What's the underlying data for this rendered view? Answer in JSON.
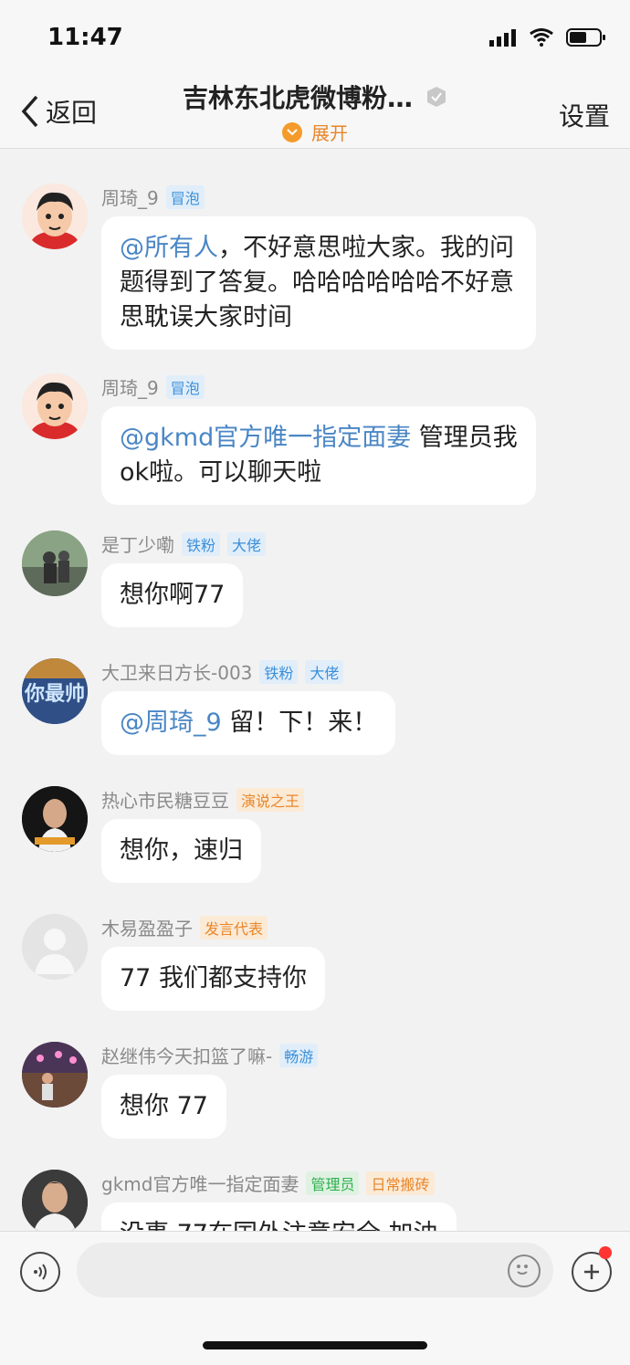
{
  "status_bar": {
    "time": "11:47"
  },
  "nav": {
    "back_label": "返回",
    "title": "吉林东北虎微博粉…",
    "expand_label": "展开",
    "settings_label": "设置"
  },
  "messages": [
    {
      "name": "周琦_9",
      "badges": [
        {
          "text": "冒泡",
          "color": "blue"
        }
      ],
      "mention": "@所有人",
      "text": "，不好意思啦大家。我的问题得到了答复。哈哈哈哈哈哈不好意思耽误大家时间"
    },
    {
      "name": "周琦_9",
      "badges": [
        {
          "text": "冒泡",
          "color": "blue"
        }
      ],
      "mention": "@gkmd官方唯一指定面妻",
      "text": " 管理员我ok啦。可以聊天啦"
    },
    {
      "name": "是丁少嘞",
      "badges": [
        {
          "text": "铁粉",
          "color": "blue"
        },
        {
          "text": "大佬",
          "color": "blue"
        }
      ],
      "mention": "",
      "text": "想你啊77"
    },
    {
      "name": "大卫来日方长-003",
      "badges": [
        {
          "text": "铁粉",
          "color": "blue"
        },
        {
          "text": "大佬",
          "color": "blue"
        }
      ],
      "mention": "@周琦_9",
      "text": " 留！下！来！"
    },
    {
      "name": "热心市民糖豆豆",
      "badges": [
        {
          "text": "演说之王",
          "color": "orange"
        }
      ],
      "mention": "",
      "text": "想你，速归"
    },
    {
      "name": "木易盈盈子",
      "badges": [
        {
          "text": "发言代表",
          "color": "orange"
        }
      ],
      "mention": "",
      "text": "77  我们都支持你"
    },
    {
      "name": "赵继伟今天扣篮了嘛-",
      "badges": [
        {
          "text": "畅游",
          "color": "blue"
        }
      ],
      "mention": "",
      "text": "想你 77"
    },
    {
      "name": "gkmd官方唯一指定面妻",
      "badges": [
        {
          "text": "管理员",
          "color": "green"
        },
        {
          "text": "日常搬砖",
          "color": "orange"
        }
      ],
      "mention": "",
      "text": "没事 77在国外注意安全 加油"
    }
  ],
  "colors": {
    "mention": "#4a86c5",
    "badge_blue": "#3b8fd9",
    "badge_orange": "#e8862a",
    "badge_green": "#2fb04d",
    "accent": "#f59b2b"
  }
}
